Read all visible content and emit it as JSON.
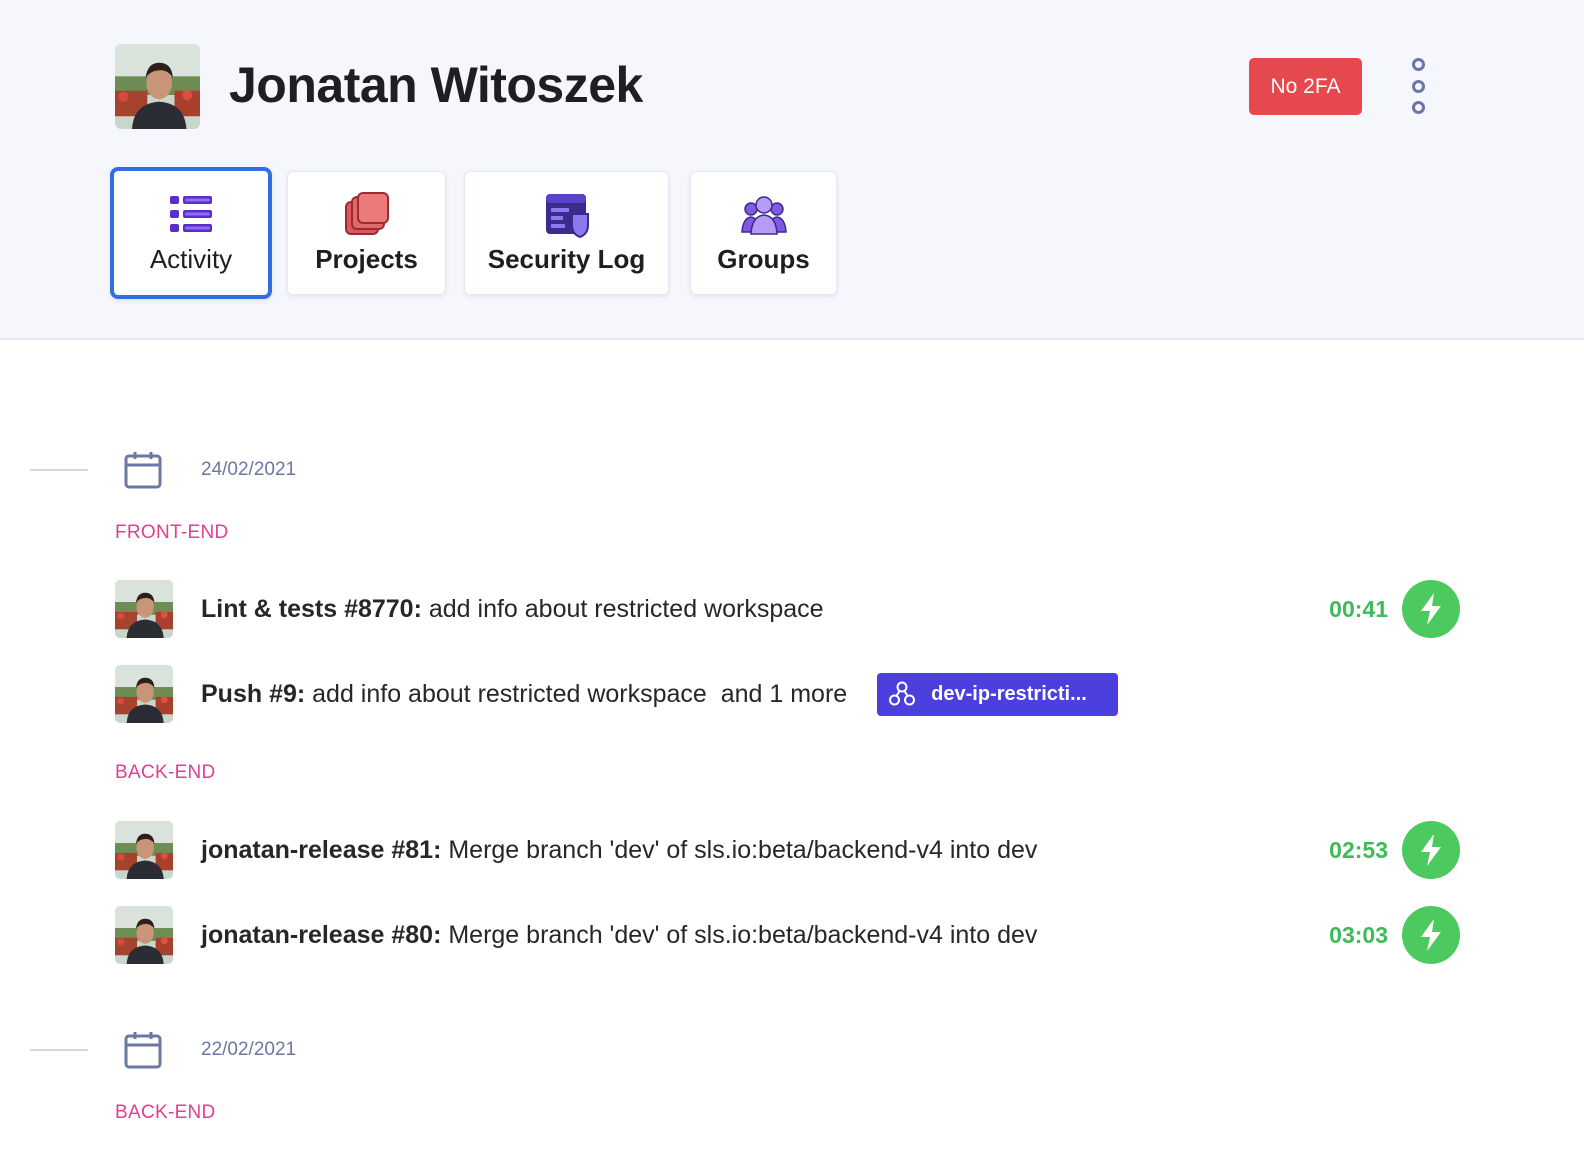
{
  "profile": {
    "name": "Jonatan Witoszek",
    "avatar_icon": "user-avatar",
    "twofa_badge": "No 2FA",
    "twofa_badge_color": "#e5484d",
    "more_icon": "more-vertical-icon"
  },
  "tabs": [
    {
      "label": "Activity",
      "icon": "list-icon",
      "active": true
    },
    {
      "label": "Projects",
      "icon": "projects-icon",
      "active": false
    },
    {
      "label": "Security Log",
      "icon": "security-log-icon",
      "active": false
    },
    {
      "label": "Groups",
      "icon": "groups-icon",
      "active": false
    }
  ],
  "colors": {
    "accent": "#2f6fe0",
    "group_label": "#e0408f",
    "success": "#4cc95f",
    "branch_chip": "#4b3fdd",
    "date": "#6b78a3"
  },
  "timeline": [
    {
      "date": "24/02/2021",
      "groups": [
        {
          "label": "FRONT-END",
          "items": [
            {
              "title": "Lint & tests #8770:",
              "message": " add info about restricted workspace",
              "duration": "00:41",
              "status_icon": "lightning-icon"
            },
            {
              "title": "Push #9:",
              "message": " add info about restricted workspace  and 1 more",
              "branch": "dev-ip-restricti..."
            }
          ]
        },
        {
          "label": "BACK-END",
          "items": [
            {
              "title": "jonatan-release #81:",
              "message": " Merge branch 'dev' of sls.io:beta/backend-v4 into dev",
              "duration": "02:53",
              "status_icon": "lightning-icon"
            },
            {
              "title": "jonatan-release #80:",
              "message": " Merge branch 'dev' of sls.io:beta/backend-v4 into dev",
              "duration": "03:03",
              "status_icon": "lightning-icon"
            }
          ]
        }
      ]
    },
    {
      "date": "22/02/2021",
      "groups": [
        {
          "label": "BACK-END",
          "items": []
        }
      ]
    }
  ]
}
